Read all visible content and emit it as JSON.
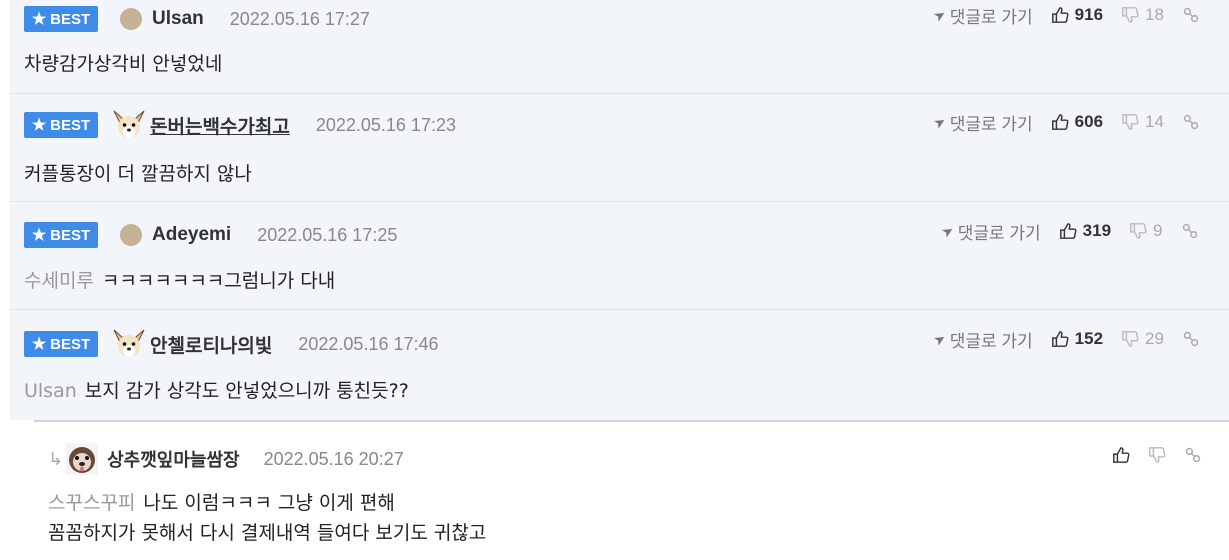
{
  "comments": [
    {
      "badge": "BEST",
      "avatar": "plain-dot",
      "nickname": "Ulsan",
      "date": "2022.05.16 17:27",
      "goto": "댓글로 가기",
      "up": "916",
      "down": "18",
      "reply_to": "",
      "text": "차량감가상각비 안넣었네"
    },
    {
      "badge": "BEST",
      "avatar": "dog",
      "nickname": "돈버는백수가최고",
      "date": "2022.05.16 17:23",
      "goto": "댓글로 가기",
      "up": "606",
      "down": "14",
      "reply_to": "",
      "text": "커플통장이 더 깔끔하지 않나"
    },
    {
      "badge": "BEST",
      "avatar": "plain-dot",
      "nickname": "Adeyemi",
      "date": "2022.05.16 17:25",
      "goto": "댓글로 가기",
      "up": "319",
      "down": "9",
      "reply_to": "수세미루",
      "text": "ㅋㅋㅋㅋㅋㅋㅋ그럼니가 다내"
    },
    {
      "badge": "BEST",
      "avatar": "dog",
      "nickname": "안첼로티나의빛",
      "date": "2022.05.16 17:46",
      "goto": "댓글로 가기",
      "up": "152",
      "down": "29",
      "reply_to": "Ulsan",
      "text": "보지 감가 상각도 안넣었으니까 퉁친듯??"
    }
  ],
  "reply": {
    "nickname": "상추깻잎마늘쌈장",
    "date": "2022.05.16 20:27",
    "reply_to": "스꾸스꾸피",
    "line1": "나도 이럼ㅋㅋㅋ 그냥 이게 편해",
    "line2": "꼼꼼하지가 못해서 다시 결제내역 들여다 보기도 귀찮고"
  },
  "colors": {
    "best_badge": "#3f8be8",
    "best_bg": "#f2f5fa"
  }
}
